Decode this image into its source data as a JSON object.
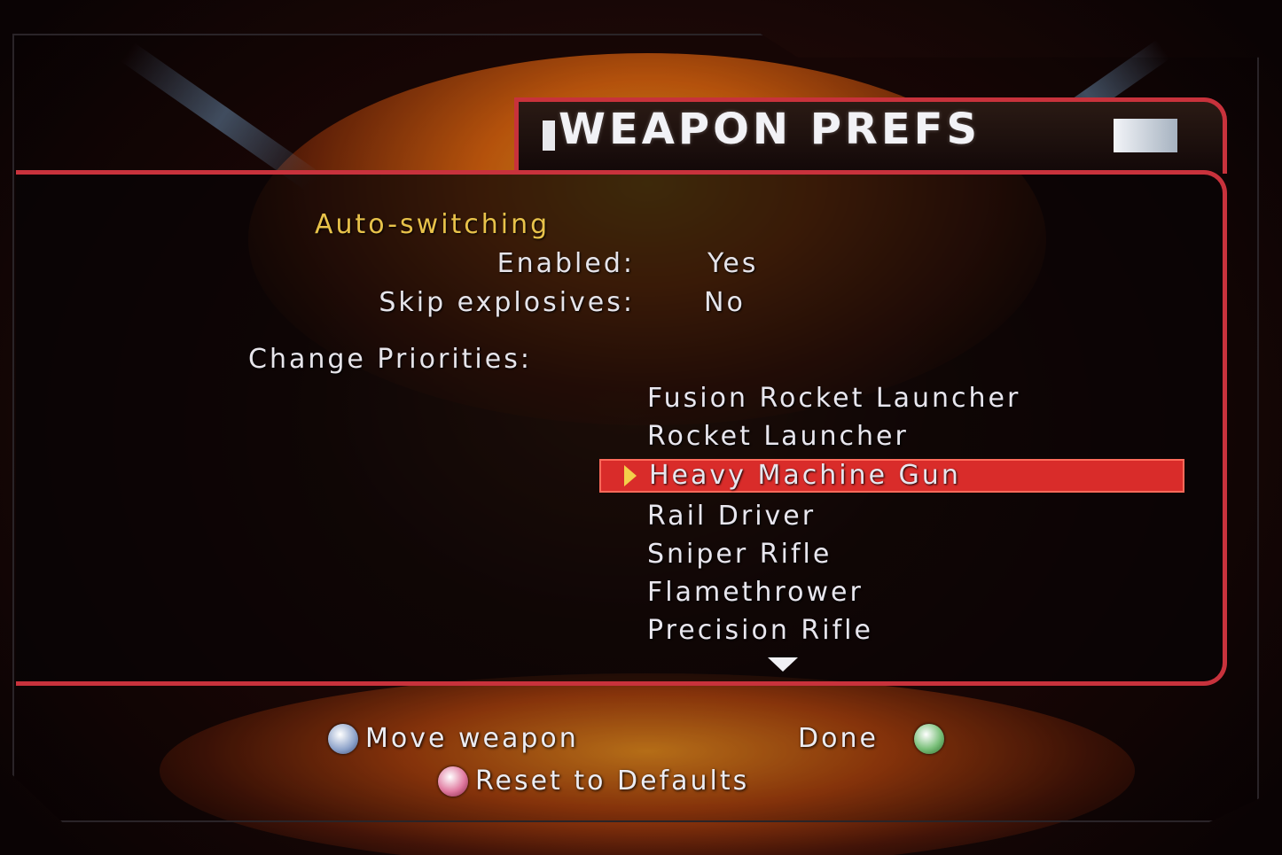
{
  "title": "WEAPON PREFS",
  "auto_switching": {
    "heading": "Auto-switching",
    "enabled_label": "Enabled:",
    "enabled_value": "Yes",
    "skip_label": "Skip explosives:",
    "skip_value": "No"
  },
  "priorities": {
    "label": "Change Priorities:",
    "weapons": [
      "Fusion Rocket Launcher",
      "Rocket Launcher",
      "Heavy Machine Gun",
      "Rail Driver",
      "Sniper Rifle",
      "Flamethrower",
      "Precision Rifle"
    ],
    "selected_index": 2
  },
  "controls": {
    "move_label": "Move weapon",
    "done_label": "Done",
    "reset_label": "Reset to Defaults",
    "move_button": "x-button-icon",
    "done_button": "a-button-icon",
    "reset_button": "b-button-icon"
  },
  "colors": {
    "accent_red": "#c8323c",
    "selection": "#d92c2a",
    "heading_gold": "#e8c24a"
  }
}
